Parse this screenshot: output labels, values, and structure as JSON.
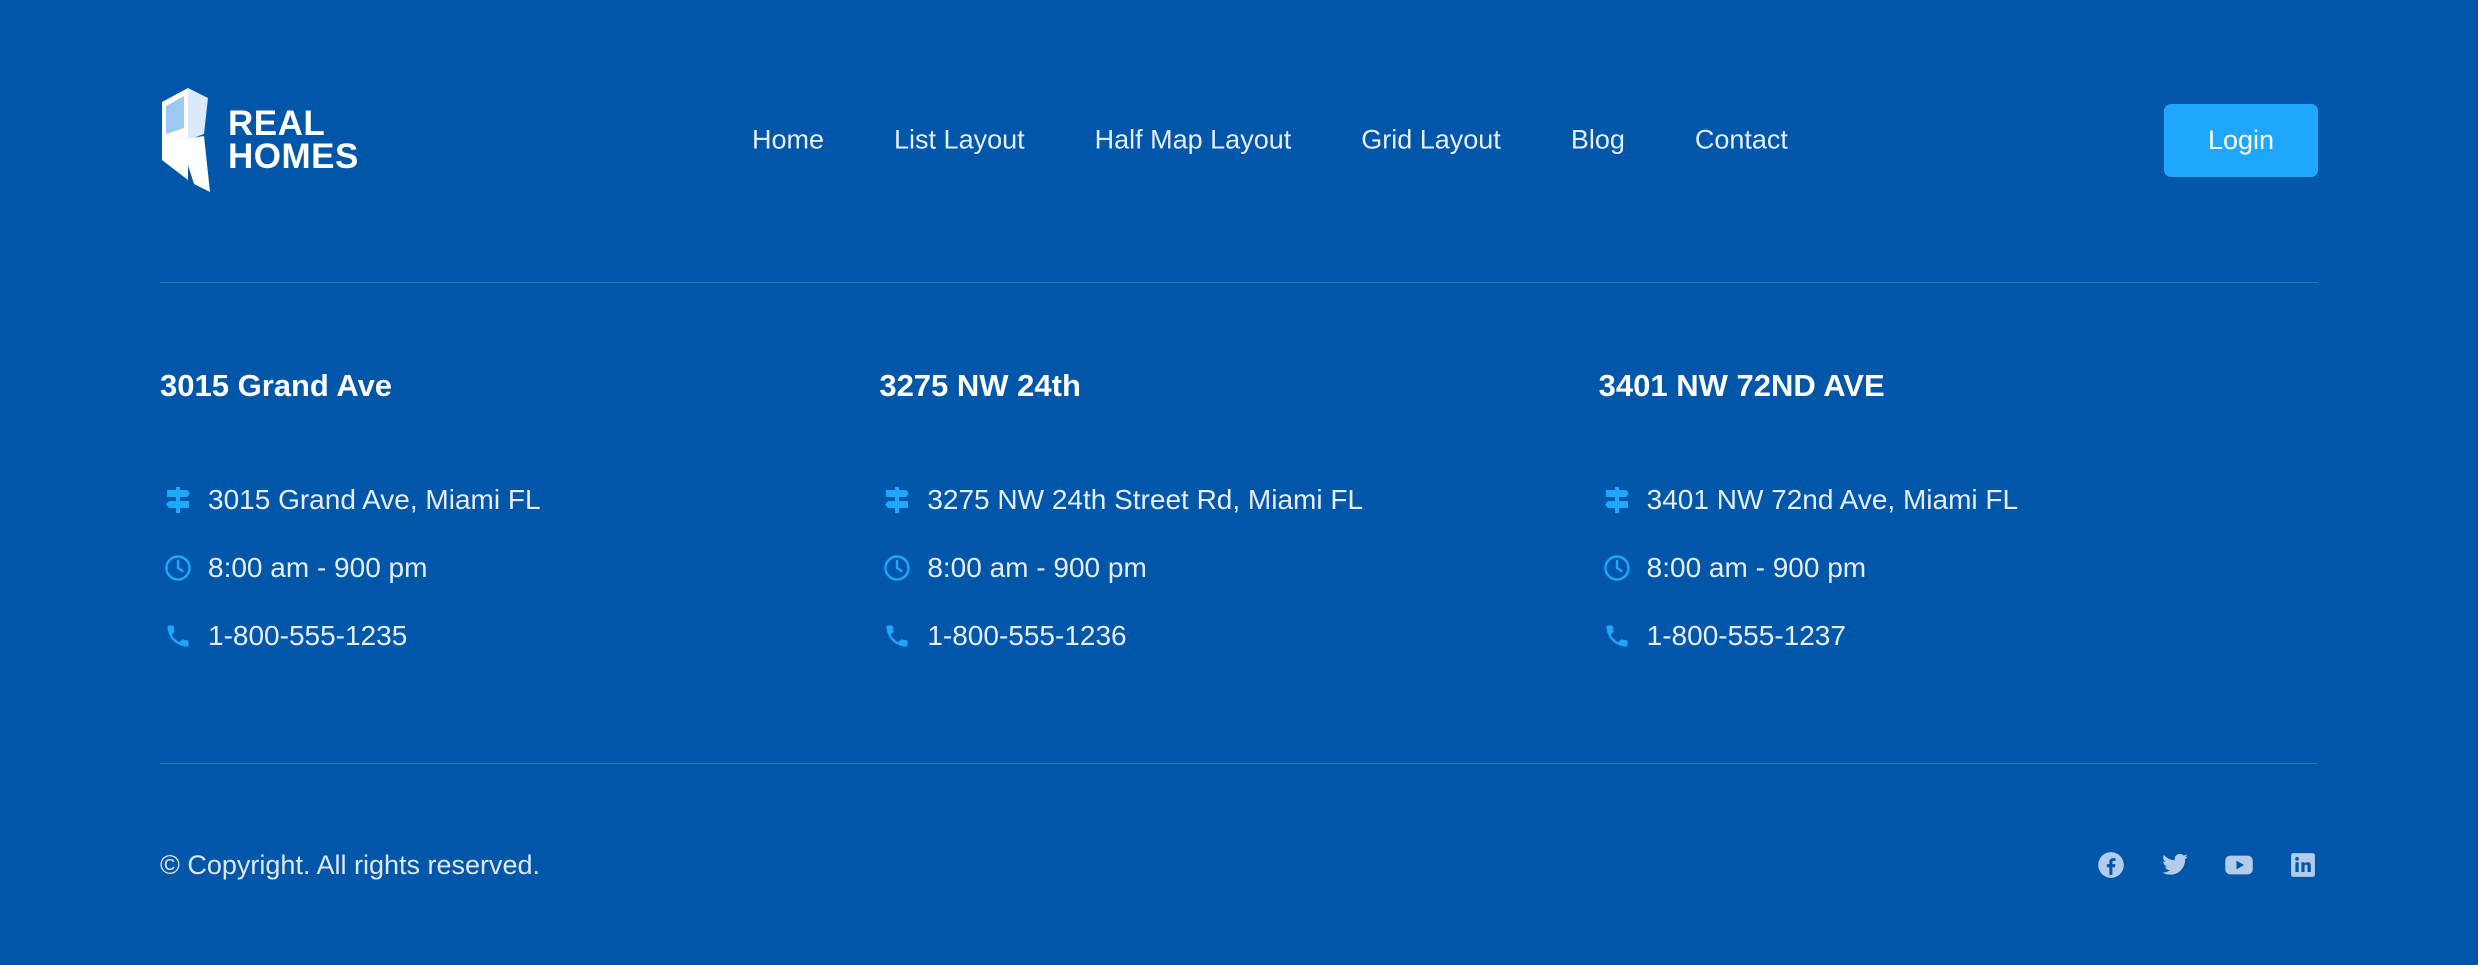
{
  "brand": {
    "line1": "REAL",
    "line2": "HOMES"
  },
  "nav": {
    "items": [
      {
        "label": "Home"
      },
      {
        "label": "List Layout"
      },
      {
        "label": "Half Map Layout"
      },
      {
        "label": "Grid Layout"
      },
      {
        "label": "Blog"
      },
      {
        "label": "Contact"
      }
    ],
    "login_label": "Login"
  },
  "locations": [
    {
      "title": "3015 Grand Ave",
      "address": "3015 Grand Ave, Miami FL",
      "hours": "8:00 am - 900 pm",
      "phone": "1-800-555-1235"
    },
    {
      "title": "3275 NW 24th",
      "address": "3275 NW 24th Street Rd, Miami FL",
      "hours": "8:00 am - 900 pm",
      "phone": "1-800-555-1236"
    },
    {
      "title": "3401 NW 72ND AVE",
      "address": "3401 NW 72nd Ave, Miami FL",
      "hours": "8:00 am - 900 pm",
      "phone": "1-800-555-1237"
    }
  ],
  "footer": {
    "copyright": "© Copyright. All rights reserved.",
    "social": [
      "facebook-icon",
      "twitter-icon",
      "youtube-icon",
      "linkedin-icon"
    ]
  },
  "colors": {
    "background": "#0056a8",
    "accent": "#1ea7fc",
    "icon": "#1ea7fc",
    "social_icon": "#b3cbed"
  }
}
